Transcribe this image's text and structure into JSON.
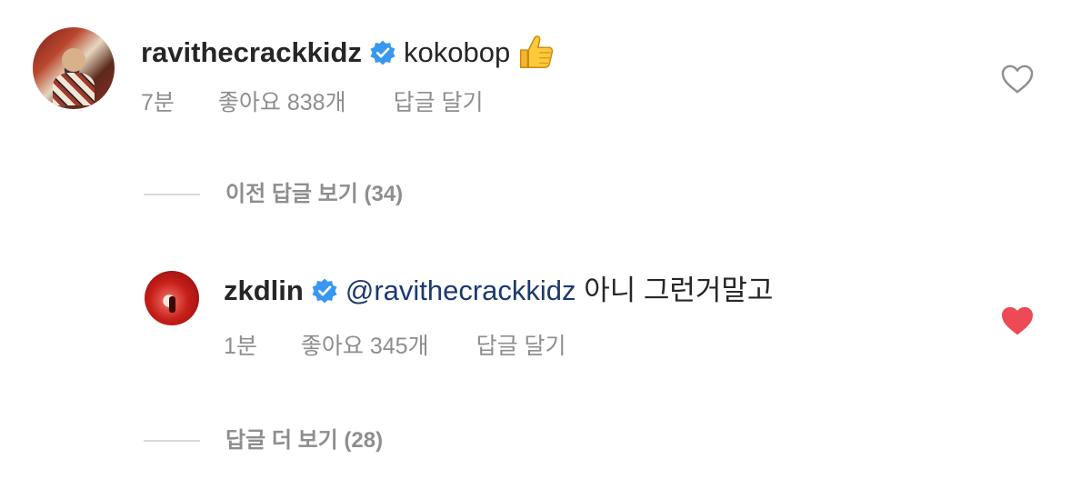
{
  "comments": [
    {
      "username": "ravithecrackkidz",
      "mention": "",
      "text": "kokobop",
      "emoji": "thumbs-up",
      "time": "7분",
      "likes": "좋아요 838개",
      "reply": "답글 달기",
      "liked": false,
      "avatar_icon": "profile-photo"
    },
    {
      "username": "zkdlin",
      "mention": "@ravithecrackkidz",
      "text": "아니 그런거말고",
      "time": "1분",
      "likes": "좋아요 345개",
      "reply": "답글 달기",
      "liked": true,
      "avatar_icon": "profile-photo"
    }
  ],
  "threads": {
    "previous_replies": "이전 답글 보기 (34)",
    "more_replies": "답글 더 보기 (28)"
  },
  "colors": {
    "verified_blue": "#3897f0",
    "heart_red": "#ed4956",
    "meta_gray": "#8e8e8e",
    "mention_blue": "#1c3a6e"
  }
}
